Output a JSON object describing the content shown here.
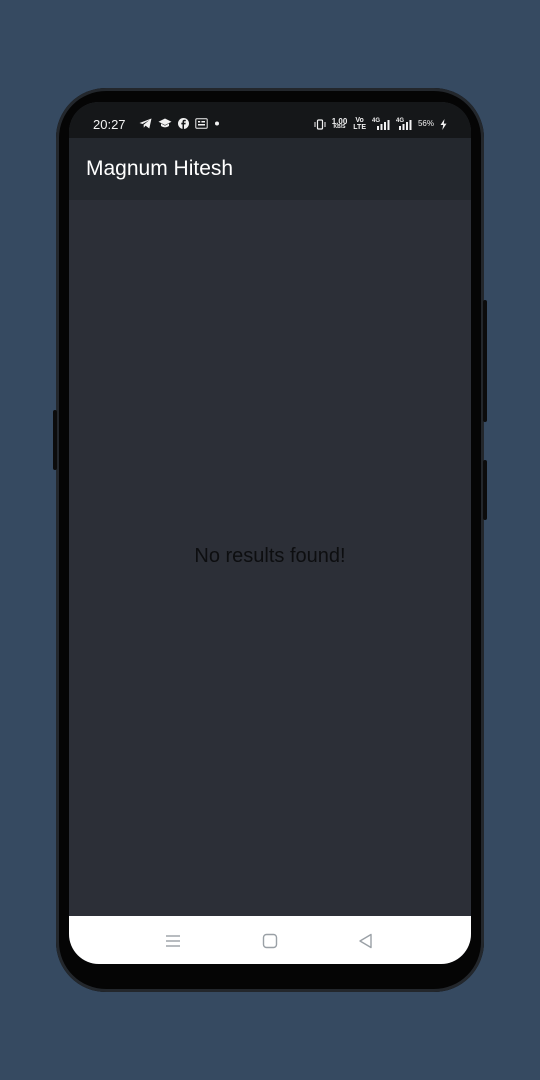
{
  "status_bar": {
    "time": "20:27",
    "left_icons": [
      "telegram-icon",
      "graduation-cap-icon",
      "facebook-icon",
      "gallery-icon",
      "dot-icon"
    ],
    "right_icons": [
      "vibrate-icon",
      "data-speed-icon",
      "volte-icon",
      "signal-4g-icon",
      "signal-4g-icon",
      "battery-charging-icon"
    ],
    "data_speed_value": "1.00",
    "data_speed_unit": "KB/S",
    "volte_top": "Vo",
    "volte_bottom": "LTE",
    "signal1_label": "4G",
    "signal2_label": "4G",
    "battery": "56%"
  },
  "app_bar": {
    "title": "Magnum Hitesh"
  },
  "content": {
    "empty_message": "No results found!"
  },
  "nav_bar": {
    "buttons": [
      "menu-icon",
      "home-icon",
      "back-icon"
    ]
  },
  "colors": {
    "page_background": "#364a61",
    "phone_body": "#050505",
    "status_bar": "#151719",
    "app_bar": "#24282e",
    "content_background": "#2c2f37",
    "nav_bar": "#ffffff"
  }
}
